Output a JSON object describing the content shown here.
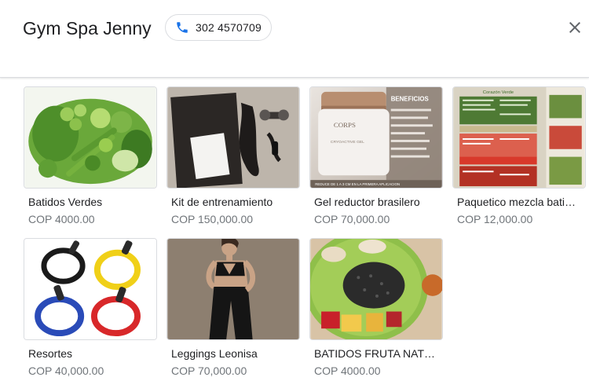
{
  "header": {
    "title": "Gym Spa Jenny",
    "phone": "302 4570709",
    "phone_icon": "phone-icon",
    "close_icon": "close-icon",
    "accent": "#1a73e8"
  },
  "products": [
    {
      "name": "Batidos Verdes",
      "price": "COP 4000.00"
    },
    {
      "name": "Kit de entrenamiento",
      "price": "COP 150,000.00"
    },
    {
      "name": "Gel reductor brasilero",
      "price": "COP 70,000.00"
    },
    {
      "name": "Paquetico mezcla bati…",
      "price": "COP 12,000.00"
    },
    {
      "name": "Resortes",
      "price": "COP 40,000.00"
    },
    {
      "name": "Leggings Leonisa",
      "price": "COP 70,000.00"
    },
    {
      "name": "BATIDOS FRUTA NATU…",
      "price": "COP 4000.00"
    }
  ],
  "gel_image": {
    "banner": "BENEFICIOS",
    "brand": "CORPS",
    "product": "CRYOACTIVE GEL",
    "footer": "REDUCE DE 1 A 3 CM EN LA PRIMERA APLICACION"
  },
  "menu_image": {
    "heading": "Corazón Verde"
  }
}
